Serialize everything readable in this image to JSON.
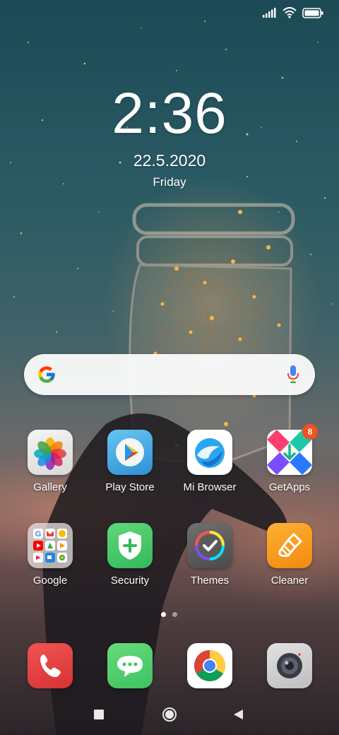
{
  "status_bar": {
    "signal_icon": "signal-bars-icon",
    "wifi_icon": "wifi-icon",
    "battery_icon": "battery-icon"
  },
  "clock": {
    "time": "2:36",
    "date": "22.5.2020",
    "weekday": "Friday"
  },
  "search": {
    "logo_icon": "google-g-icon",
    "mic_icon": "microphone-icon"
  },
  "apps": [
    {
      "label": "Gallery",
      "icon": "gallery-pinwheel-icon"
    },
    {
      "label": "Play Store",
      "icon": "play-store-icon"
    },
    {
      "label": "Mi Browser",
      "icon": "mi-browser-icon"
    },
    {
      "label": "GetApps",
      "icon": "getapps-icon",
      "badge": "8"
    },
    {
      "label": "Google",
      "icon": "google-folder-icon"
    },
    {
      "label": "Security",
      "icon": "security-shield-icon"
    },
    {
      "label": "Themes",
      "icon": "themes-icon"
    },
    {
      "label": "Cleaner",
      "icon": "cleaner-brush-icon"
    }
  ],
  "page_indicator": {
    "pages": 2,
    "current": 1
  },
  "dock": [
    {
      "icon": "phone-icon"
    },
    {
      "icon": "messages-icon"
    },
    {
      "icon": "chrome-icon"
    },
    {
      "icon": "camera-icon"
    }
  ],
  "nav": {
    "recents_icon": "recents-square-icon",
    "home_icon": "home-circle-icon",
    "back_icon": "back-triangle-icon"
  },
  "colors": {
    "badge": "#f4511e",
    "dot_active": "#ffffff",
    "dot_inactive": "#9aa0a0"
  }
}
